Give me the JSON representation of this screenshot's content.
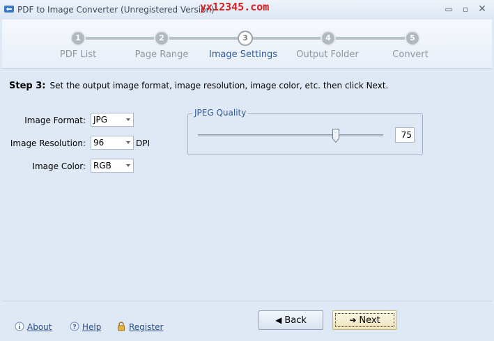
{
  "window": {
    "title": "PDF to Image Converter (Unregistered Version)",
    "watermark": "yx12345.com",
    "controls": {
      "minimize": "▭",
      "maximize": "▫",
      "close": "✕"
    }
  },
  "steps": [
    {
      "number": "1",
      "label": "PDF List",
      "active": false
    },
    {
      "number": "2",
      "label": "Page Range",
      "active": false
    },
    {
      "number": "3",
      "label": "Image Settings",
      "active": true
    },
    {
      "number": "4",
      "label": "Output Folder",
      "active": false
    },
    {
      "number": "5",
      "label": "Convert",
      "active": false
    }
  ],
  "main": {
    "step_title": "Step 3:",
    "step_description": "Set the output image format, image resolution, image color, etc. then click Next.",
    "image_format": {
      "label": "Image Format:",
      "value": "JPG"
    },
    "image_resolution": {
      "label": "Image Resolution:",
      "value": "96",
      "unit": "DPI"
    },
    "image_color": {
      "label": "Image Color:",
      "value": "RGB"
    },
    "jpeg_quality": {
      "title": "JPEG Quality",
      "value": "75",
      "slider_fraction": 0.75
    }
  },
  "footer": {
    "about": "About",
    "help": "Help",
    "register": "Register",
    "back": "Back",
    "next": "Next"
  },
  "colors": {
    "background": "#dfe9f5",
    "accent": "#2f5b9a",
    "watermark": "#d81f1f"
  }
}
